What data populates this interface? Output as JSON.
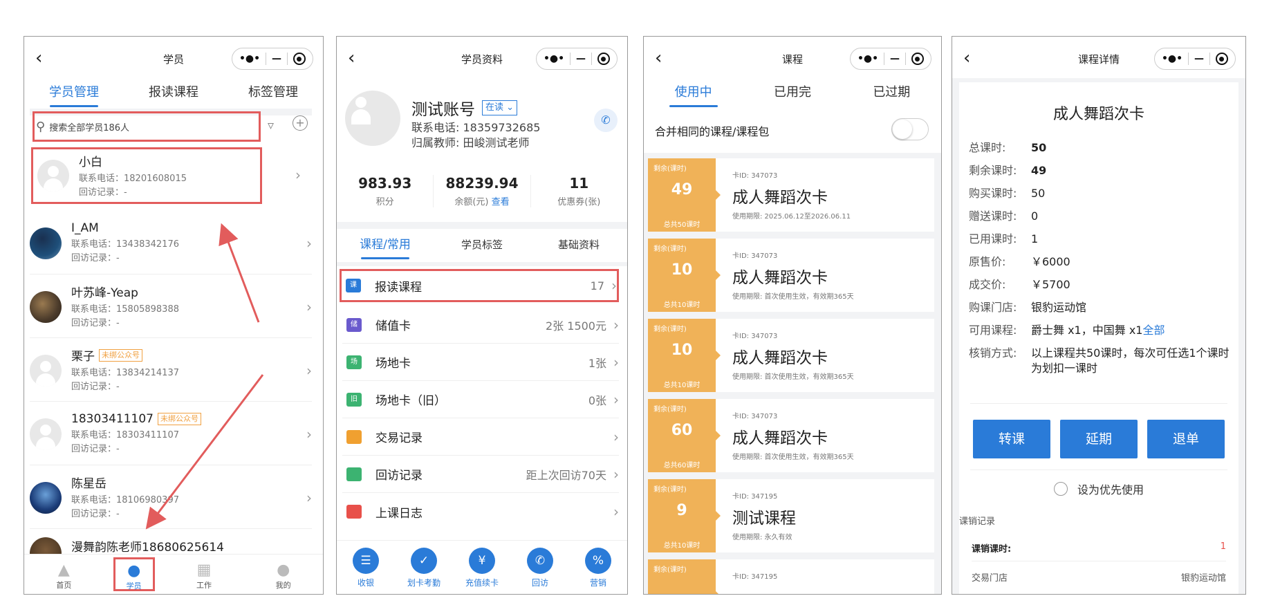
{
  "colors": {
    "accent": "#2a7bd8",
    "highlight": "#e25c5c",
    "card": "#f0b258"
  },
  "screen1": {
    "title": "学员",
    "tabs": [
      "学员管理",
      "报读课程",
      "标签管理"
    ],
    "search_placeholder": "搜索全部学员186人",
    "students": [
      {
        "name": "小白",
        "phone": "联系电话：18201608015",
        "visit": "回访记录：-",
        "badge": ""
      },
      {
        "name": "I_AM",
        "phone": "联系电话：13438342176",
        "visit": "回访记录：-",
        "badge": ""
      },
      {
        "name": "叶苏峰-Yeap",
        "phone": "联系电话：15805898388",
        "visit": "回访记录：-",
        "badge": ""
      },
      {
        "name": "栗子",
        "phone": "联系电话：13834214137",
        "visit": "回访记录：-",
        "badge": "未绑公众号"
      },
      {
        "name": "18303411107",
        "phone": "联系电话：18303411107",
        "visit": "回访记录：-",
        "badge": "未绑公众号"
      },
      {
        "name": "陈星岳",
        "phone": "联系电话：18106980397",
        "visit": "回访记录：-",
        "badge": ""
      },
      {
        "name": "漫舞韵陈老师18680625614",
        "phone": "",
        "visit": "",
        "badge": ""
      }
    ],
    "bottom_nav": [
      "首页",
      "学员",
      "工作",
      "我的"
    ]
  },
  "screen2": {
    "title": "学员资料",
    "name": "测试账号",
    "status": "在读",
    "phone": "联系电话: 18359732685",
    "teacher": "归属教师: 田峻测试老师",
    "stats": [
      {
        "value": "983.93",
        "label": "积分",
        "link": ""
      },
      {
        "value": "88239.94",
        "label": "余额(元)",
        "link": "查看"
      },
      {
        "value": "11",
        "label": "优惠券(张)",
        "link": ""
      }
    ],
    "tabs": [
      "课程/常用",
      "学员标签",
      "基础资料"
    ],
    "menu": [
      {
        "label": "报读课程",
        "value": "17",
        "icon": "课"
      },
      {
        "label": "储值卡",
        "value": "2张 1500元",
        "icon": "储"
      },
      {
        "label": "场地卡",
        "value": "1张",
        "icon": "场"
      },
      {
        "label": "场地卡（旧）",
        "value": "0张",
        "icon": "旧"
      },
      {
        "label": "交易记录",
        "value": "",
        "icon": ""
      },
      {
        "label": "回访记录",
        "value": "距上次回访70天",
        "icon": ""
      },
      {
        "label": "上课日志",
        "value": "",
        "icon": ""
      }
    ],
    "actions": [
      "收银",
      "划卡考勤",
      "充值续卡",
      "回访",
      "营销"
    ]
  },
  "screen3": {
    "title": "课程",
    "tabs": [
      "使用中",
      "已用完",
      "已过期"
    ],
    "merge_label": "合并相同的课程/课程包",
    "cards": [
      {
        "remain_label": "剩余(课时)",
        "remain": "49",
        "total": "总共50课时",
        "card_id": "卡ID: 347073",
        "name": "成人舞蹈次卡",
        "valid": "使用期限: 2025.06.12至2026.06.11"
      },
      {
        "remain_label": "剩余(课时)",
        "remain": "10",
        "total": "总共10课时",
        "card_id": "卡ID: 347073",
        "name": "成人舞蹈次卡",
        "valid": "使用期限: 首次使用生效，有效期365天"
      },
      {
        "remain_label": "剩余(课时)",
        "remain": "10",
        "total": "总共10课时",
        "card_id": "卡ID: 347073",
        "name": "成人舞蹈次卡",
        "valid": "使用期限: 首次使用生效，有效期365天"
      },
      {
        "remain_label": "剩余(课时)",
        "remain": "60",
        "total": "总共60课时",
        "card_id": "卡ID: 347073",
        "name": "成人舞蹈次卡",
        "valid": "使用期限: 首次使用生效，有效期365天"
      },
      {
        "remain_label": "剩余(课时)",
        "remain": "9",
        "total": "总共10课时",
        "card_id": "卡ID: 347195",
        "name": "测试课程",
        "valid": "使用期限: 永久有效"
      },
      {
        "remain_label": "剩余(课时)",
        "remain": "",
        "total": "",
        "card_id": "卡ID: 347195",
        "name": "",
        "valid": ""
      }
    ]
  },
  "screen4": {
    "title": "课程详情",
    "card_name": "成人舞蹈次卡",
    "details": [
      {
        "k": "总课时:",
        "v": "50"
      },
      {
        "k": "剩余课时:",
        "v": "49"
      },
      {
        "k": "购买课时:",
        "v": "50"
      },
      {
        "k": "赠送课时:",
        "v": "0"
      },
      {
        "k": "已用课时:",
        "v": "1"
      },
      {
        "k": "原售价:",
        "v": "￥6000"
      },
      {
        "k": "成交价:",
        "v": "￥5700"
      },
      {
        "k": "购课门店:",
        "v": "银豹运动馆"
      },
      {
        "k": "可用课程:",
        "v": "爵士舞 x1，中国舞 x1"
      },
      {
        "k": "核销方式:",
        "v": "以上课程共50课时，每次可任选1个课时为划扣一课时"
      }
    ],
    "all_link": "全部",
    "buttons": [
      "转课",
      "延期",
      "退单"
    ],
    "priority_label": "设为优先使用",
    "section": "课销记录",
    "rec1_label": "课销课时:",
    "rec1_value": "1",
    "rec2_label": "交易门店",
    "rec2_value": "银豹运动馆"
  }
}
